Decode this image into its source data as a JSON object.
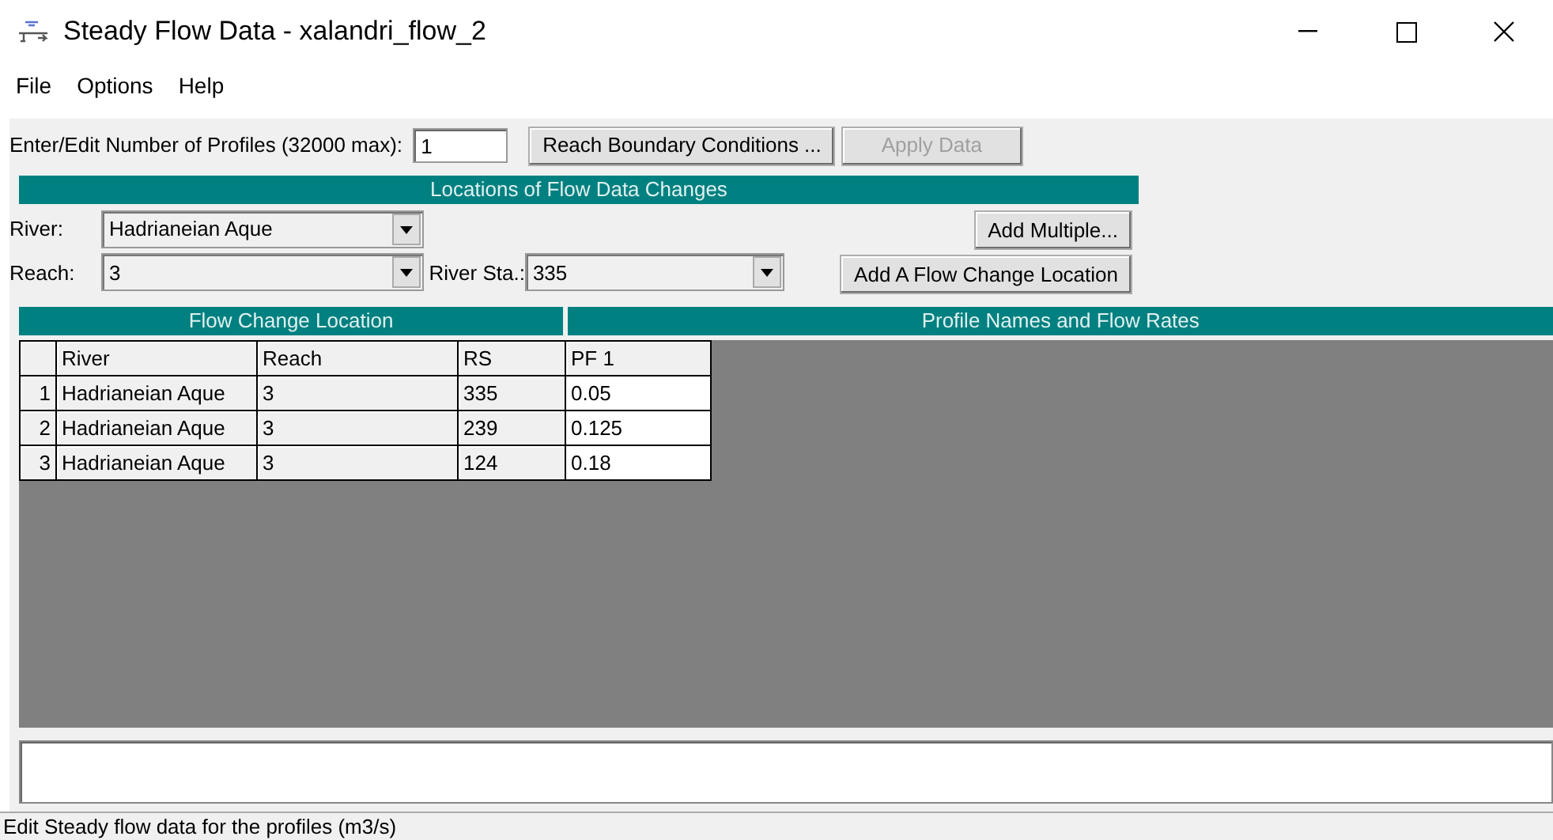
{
  "window": {
    "title": "Steady Flow Data - xalandri_flow_2"
  },
  "menu": [
    "File",
    "Options",
    "Help"
  ],
  "profiles": {
    "label": "Enter/Edit Number of Profiles (32000 max):",
    "value": "1"
  },
  "top_buttons": [
    {
      "label": "Reach Boundary Conditions ...",
      "disabled": false
    },
    {
      "label": "Apply Data",
      "disabled": true
    }
  ],
  "locations": {
    "title": "Locations of Flow Data Changes",
    "river": {
      "label": "River:",
      "value": "Hadrianeian Aque"
    },
    "add_multiple": "Add Multiple...",
    "reach": {
      "label": "Reach:",
      "value": "3"
    },
    "river_station": {
      "label": "River Sta.:",
      "value": "335"
    },
    "add_location": "Add A Flow Change Location"
  },
  "table": {
    "left_title": "Flow Change Location",
    "right_title": "Profile Names and Flow Rates",
    "columns": [
      "River",
      "Reach",
      "RS",
      "PF 1"
    ],
    "rows": [
      {
        "number": "1",
        "river": "Hadrianeian Aque",
        "reach": "3",
        "rs": "335",
        "flow": "0.05"
      },
      {
        "number": "2",
        "river": "Hadrianeian Aque",
        "reach": "3",
        "rs": "239",
        "flow": "0.125"
      },
      {
        "number": "3",
        "river": "Hadrianeian Aque",
        "reach": "3",
        "rs": "124",
        "flow": "0.18"
      }
    ]
  },
  "status_bar": "Edit Steady flow data for the profiles (m3/s)"
}
